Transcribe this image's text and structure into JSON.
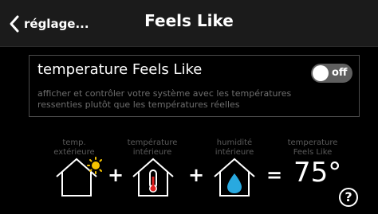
{
  "header": {
    "back_label": "réglage...",
    "title": "Feels Like"
  },
  "setting": {
    "title": "temperature Feels Like",
    "description": "afficher et contrôler votre système avec les températures ressenties plutôt que les températures réelles",
    "toggle_state": "off"
  },
  "equation": {
    "outdoor_label": "temp. extérieure",
    "indoor_temp_label": "température intérieure",
    "indoor_humidity_label": "humidité intérieure",
    "feels_like_label": "temperature Feels Like",
    "plus_1": "+",
    "plus_2": "+",
    "equals": "=",
    "value": "75°"
  },
  "help": {
    "label": "?"
  },
  "icons": {
    "back": "chevron-left-icon",
    "outdoor": "house-sun-icon",
    "indoor_temp": "house-thermometer-icon",
    "indoor_humidity": "house-water-drop-icon",
    "help": "question-mark-icon"
  },
  "colors": {
    "header_bg": "#1b1b1b",
    "background": "#000000",
    "sun": "#f5c400",
    "drop": "#29a9e0",
    "thermometer": "#e02020",
    "toggle_off": "#5f5f5f",
    "label_grey": "#5a5a5a"
  }
}
